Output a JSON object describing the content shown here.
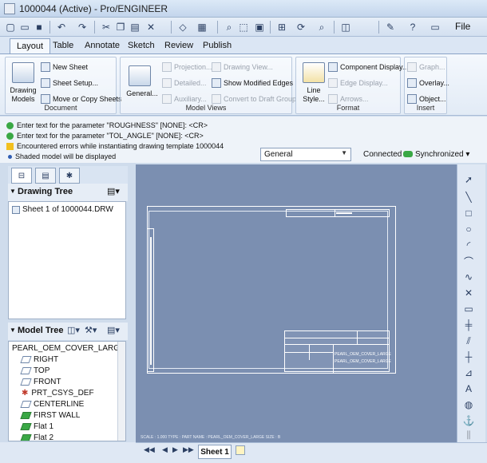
{
  "window": {
    "title": "1000044 (Active) - Pro/ENGINEER"
  },
  "menu": {
    "file_label": "File"
  },
  "tabs": [
    "Layout",
    "Table",
    "Annotate",
    "Sketch",
    "Review",
    "Publish"
  ],
  "ribbon": {
    "document": {
      "label": "Document",
      "drawing_models": "Drawing Models",
      "new_sheet": "New Sheet",
      "sheet_setup": "Sheet Setup...",
      "move_copy": "Move or Copy Sheets"
    },
    "model_views": {
      "label": "Model Views",
      "general": "General...",
      "projection": "Projection...",
      "detailed": "Detailed...",
      "auxiliary": "Auxiliary...",
      "drawing_view": "Drawing View...",
      "show_modified_edges": "Show Modified Edges",
      "convert_draft": "Convert to Draft Group"
    },
    "format": {
      "label": "Format",
      "line_style": "Line Style...",
      "component_display": "Component Display...",
      "edge_display": "Edge Display...",
      "arrows": "Arrows..."
    },
    "insert": {
      "label": "Insert",
      "graph": "Graph...",
      "overlay": "Overlay...",
      "object": "Object..."
    }
  },
  "messages": [
    "Enter text for the parameter \"ROUGHNESS\" [NONE]:    <CR>",
    "Enter text for the parameter \"TOL_ANGLE\" [NONE]:    <CR>",
    "Encountered errors while instantiating drawing template 1000044",
    "Shaded model will be displayed"
  ],
  "filter_select": {
    "value": "General"
  },
  "status": {
    "connected": "Connected",
    "synchronized": "Synchronized"
  },
  "drawing_tree": {
    "title": "Drawing Tree",
    "items": [
      "Sheet 1 of 1000044.DRW"
    ]
  },
  "model_tree": {
    "title": "Model Tree",
    "items": [
      "PEARL_OEM_COVER_LARGE.PRT",
      "RIGHT",
      "TOP",
      "FRONT",
      "PRT_CSYS_DEF",
      "CENTERLINE",
      "FIRST WALL",
      "Flat 1",
      "Flat 2"
    ]
  },
  "drawing": {
    "title_block_text": "PEARL_OEM_COVER_LARGE",
    "footer": "SCALE : 1.000     TYPE : PART     NAME : PEARL_OEM_COVER_LARGE     SIZE : B"
  },
  "sheet_tabs": [
    "Sheet 1"
  ],
  "colors": {
    "canvas": "#7b8fb1",
    "ribbon": "#e2ebf6",
    "accent": "#8aa3c6"
  }
}
